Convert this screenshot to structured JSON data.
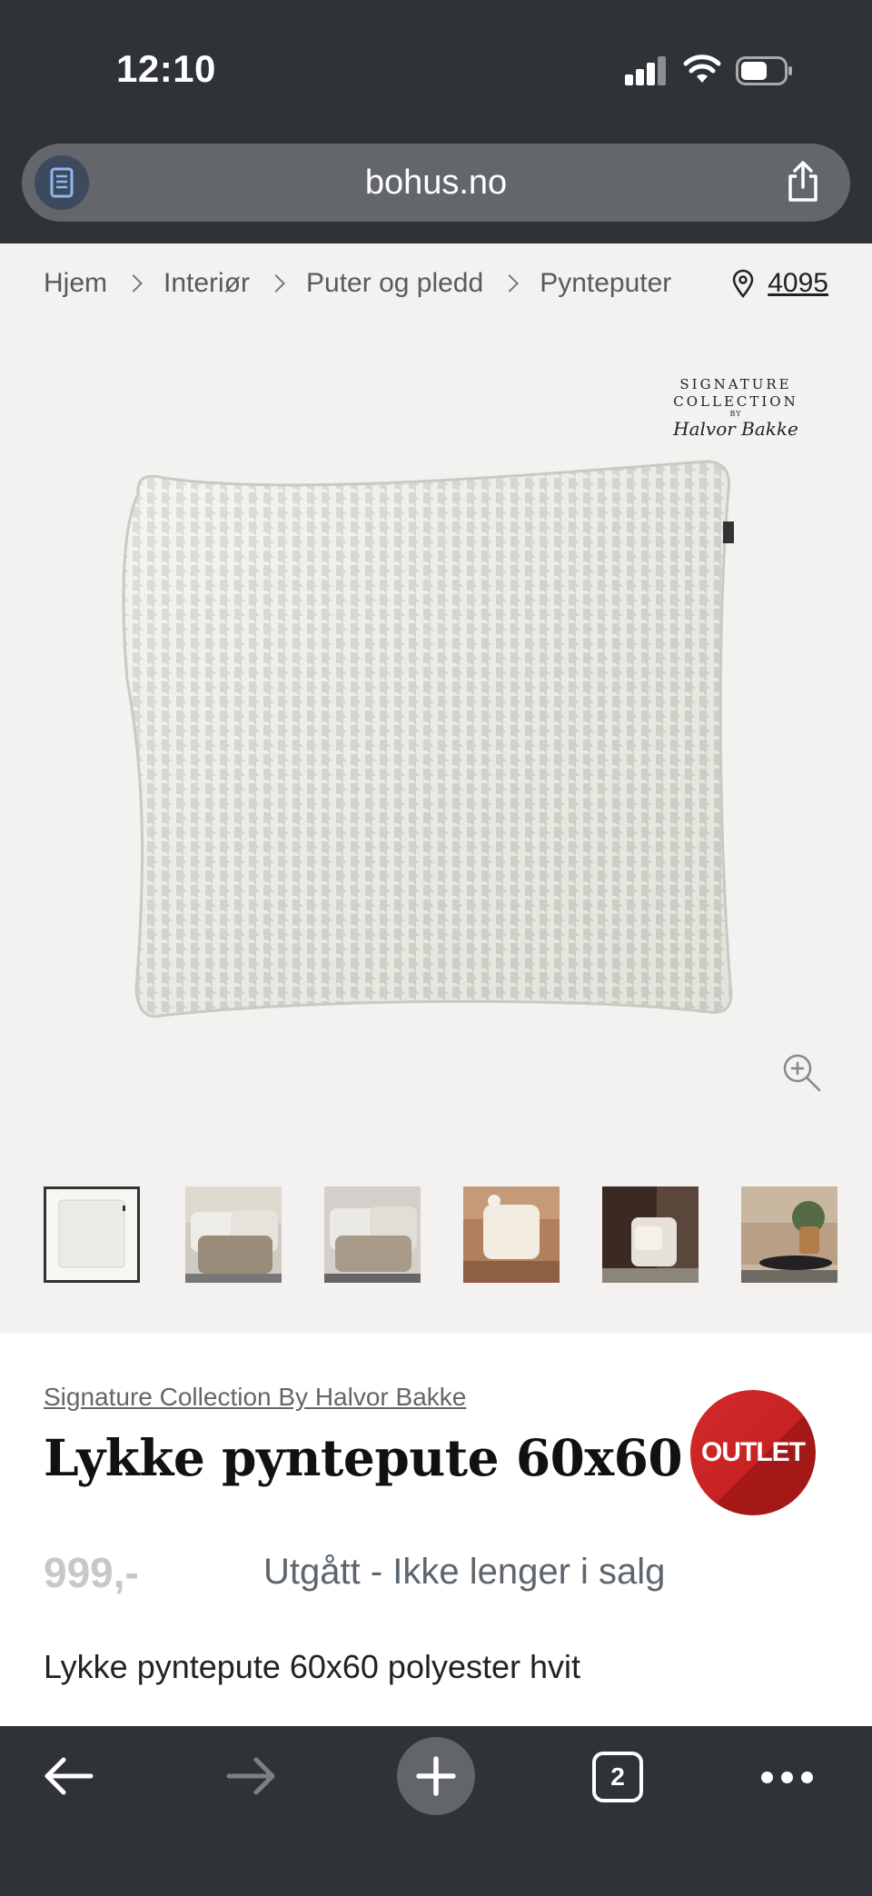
{
  "status_bar": {
    "time": "12:10"
  },
  "browser": {
    "url": "bohus.no",
    "tab_count": "2"
  },
  "breadcrumb": {
    "items": [
      "Hjem",
      "Interiør",
      "Puter og pledd",
      "Pynteputer"
    ],
    "store_number": "4095"
  },
  "gallery": {
    "signature_logo": {
      "line1": "SIGNATURE",
      "line2": "COLLECTION",
      "line3": "BY",
      "signature": "Halvor Bakke"
    },
    "thumbnail_count": 6,
    "active_thumbnail": 1
  },
  "product": {
    "brand": "Signature Collection By Halvor Bakke",
    "title": "Lykke pyntepute 60x60",
    "badge": "OUTLET",
    "price": "999,-",
    "availability": "Utgått - Ikke lenger i salg",
    "description": "Lykke pyntepute 60x60 polyester hvit"
  },
  "colors": {
    "chrome": "#2f3236",
    "outlet_red": "#c82222",
    "gallery_bg": "#f4f2f0"
  },
  "icons": [
    "reader-icon",
    "share-icon",
    "location-pin-icon",
    "zoom-in-icon",
    "back-arrow-icon",
    "forward-arrow-icon",
    "plus-icon",
    "tabs-icon",
    "more-icon"
  ]
}
